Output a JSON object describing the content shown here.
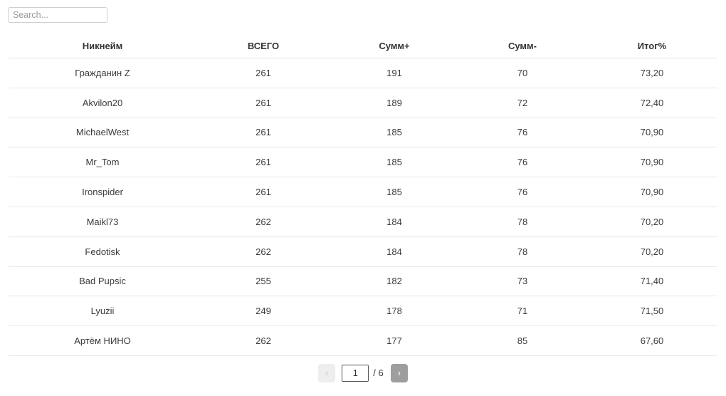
{
  "search": {
    "placeholder": "Search...",
    "value": ""
  },
  "table": {
    "columns": [
      {
        "key": "nickname",
        "label": "Никнейм"
      },
      {
        "key": "total",
        "label": "ВСЕГО"
      },
      {
        "key": "plus",
        "label": "Сумм+"
      },
      {
        "key": "minus",
        "label": "Сумм-"
      },
      {
        "key": "percent",
        "label": "Итог%"
      }
    ],
    "rows": [
      {
        "nickname": "Гражданин Z",
        "total": "261",
        "plus": "191",
        "minus": "70",
        "percent": "73,20"
      },
      {
        "nickname": "Akvilon20",
        "total": "261",
        "plus": "189",
        "minus": "72",
        "percent": "72,40"
      },
      {
        "nickname": "MichaelWest",
        "total": "261",
        "plus": "185",
        "minus": "76",
        "percent": "70,90"
      },
      {
        "nickname": "Mr_Tom",
        "total": "261",
        "plus": "185",
        "minus": "76",
        "percent": "70,90"
      },
      {
        "nickname": "Ironspider",
        "total": "261",
        "plus": "185",
        "minus": "76",
        "percent": "70,90"
      },
      {
        "nickname": "Maikl73",
        "total": "262",
        "plus": "184",
        "minus": "78",
        "percent": "70,20"
      },
      {
        "nickname": "Fedotisk",
        "total": "262",
        "plus": "184",
        "minus": "78",
        "percent": "70,20"
      },
      {
        "nickname": "Bad Pupsic",
        "total": "255",
        "plus": "182",
        "minus": "73",
        "percent": "71,40"
      },
      {
        "nickname": "Lyuzii",
        "total": "249",
        "plus": "178",
        "minus": "71",
        "percent": "71,50"
      },
      {
        "nickname": "Артём НИНО",
        "total": "262",
        "plus": "177",
        "minus": "85",
        "percent": "67,60"
      }
    ]
  },
  "pagination": {
    "prev_label": "‹",
    "next_label": "›",
    "current_page": "1",
    "total_pages_label": "/ 6"
  },
  "colors": {
    "next_button_bg": "#9e9e9e",
    "prev_button_bg": "#eeeeee",
    "row_border": "#e8e8e8",
    "text": "#333333"
  }
}
